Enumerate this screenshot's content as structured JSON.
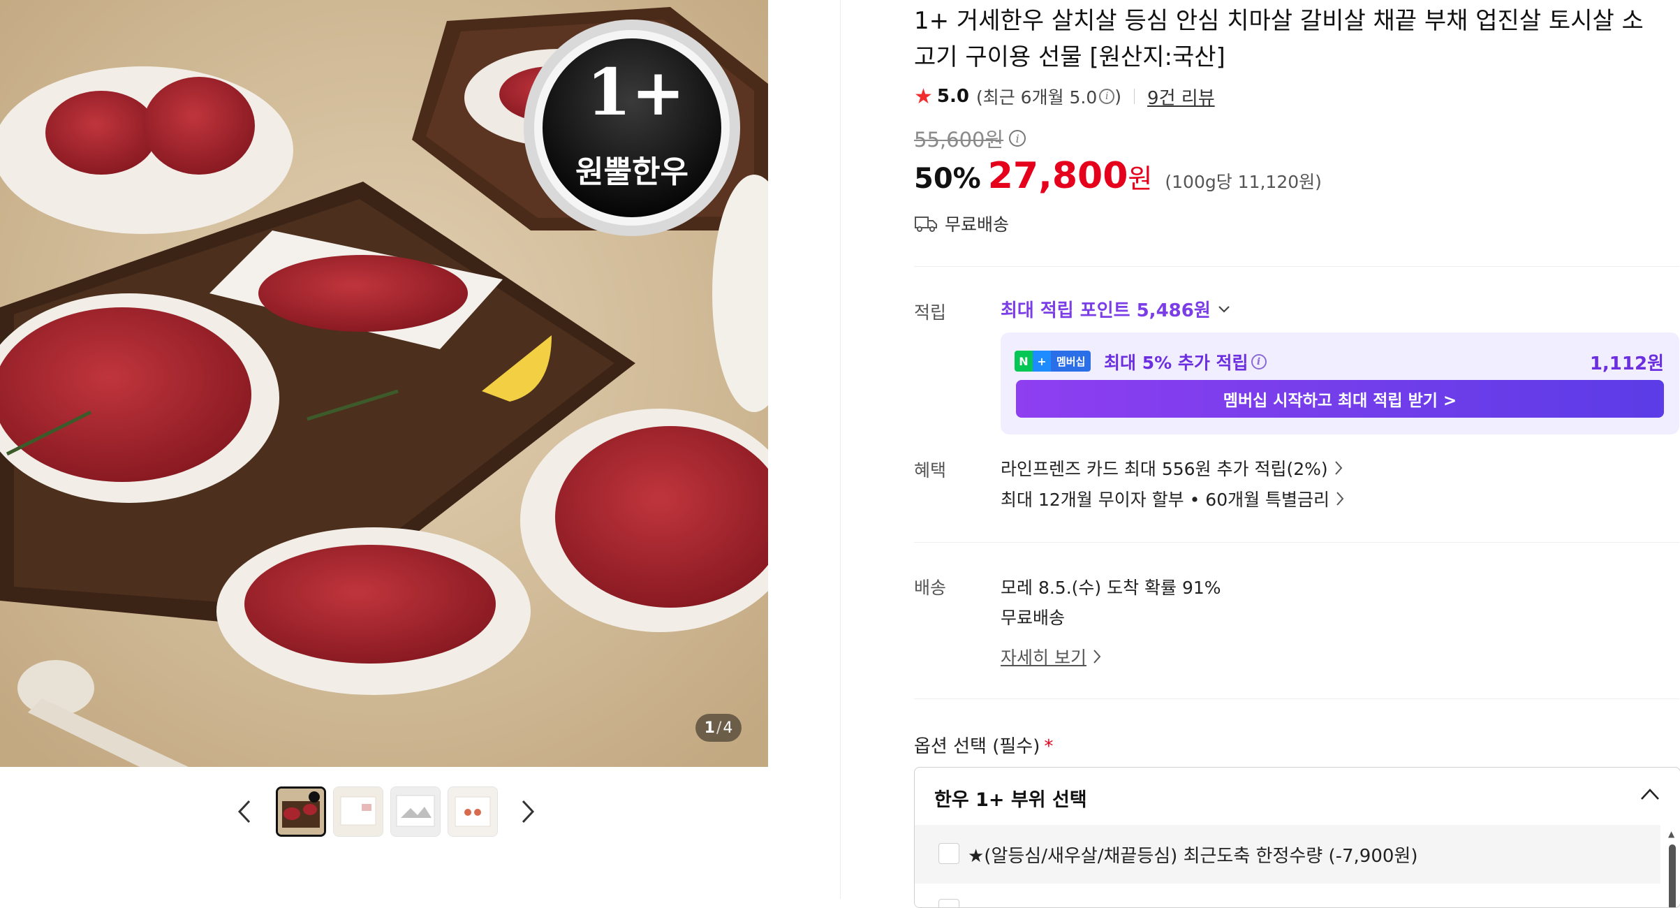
{
  "gallery": {
    "badge_top": "1+",
    "badge_bottom": "원뿔한우",
    "counter_current": "1",
    "counter_separator": "/",
    "counter_total": "4",
    "thumbnail_count": 4
  },
  "product": {
    "title": "1+ 거세한우 살치살 등심 안심 치마살 갈비살 채끝 부채 업진살 토시살 소고기 구이용 선물 [원산지:국산]",
    "rating_score": "5.0",
    "rating_recent": "(최근 6개월 5.0",
    "rating_recent_close": ")",
    "review_link": "9건 리뷰",
    "original_price": "55,600원",
    "discount": "50%",
    "sale_price": "27,800",
    "sale_currency": "원",
    "unit_price": "(100g당 11,120원)",
    "shipping_short": "무료배송"
  },
  "points": {
    "label": "적립",
    "headline": "최대 적립 포인트 5,486원",
    "badge_n": "N",
    "badge_plus": "+",
    "badge_text": "멤버십",
    "membership_text": "최대 5% 추가 적립",
    "membership_amount": "1,112원",
    "membership_button": "멤버십 시작하고 최대 적립 받기 >"
  },
  "benefits": {
    "label": "혜택",
    "line1": "라인프렌즈 카드 최대 556원 추가 적립(2%)",
    "line2": "최대 12개월 무이자 할부 • 60개월 특별금리"
  },
  "delivery": {
    "label": "배송",
    "arrival": "모레 8.5.(수) 도착 확률 91%",
    "fee": "무료배송",
    "detail_link": "자세히 보기"
  },
  "options": {
    "title": "옵션 선택 (필수)",
    "required_mark": "*",
    "select_label": "한우 1+ 부위 선택",
    "option1": "★(알등심/새우살/채끝등심) 최근도축 한정수량 (-7,900원)"
  },
  "colors": {
    "sale_red": "#e5001b",
    "points_purple": "#7a3de6",
    "membership_bg": "#f1efff",
    "naver_green": "#06c755"
  },
  "icons": [
    "star-icon",
    "info-icon",
    "truck-icon",
    "chevron-down-icon",
    "chevron-right-icon",
    "chevron-left-icon",
    "chevron-up-icon"
  ]
}
